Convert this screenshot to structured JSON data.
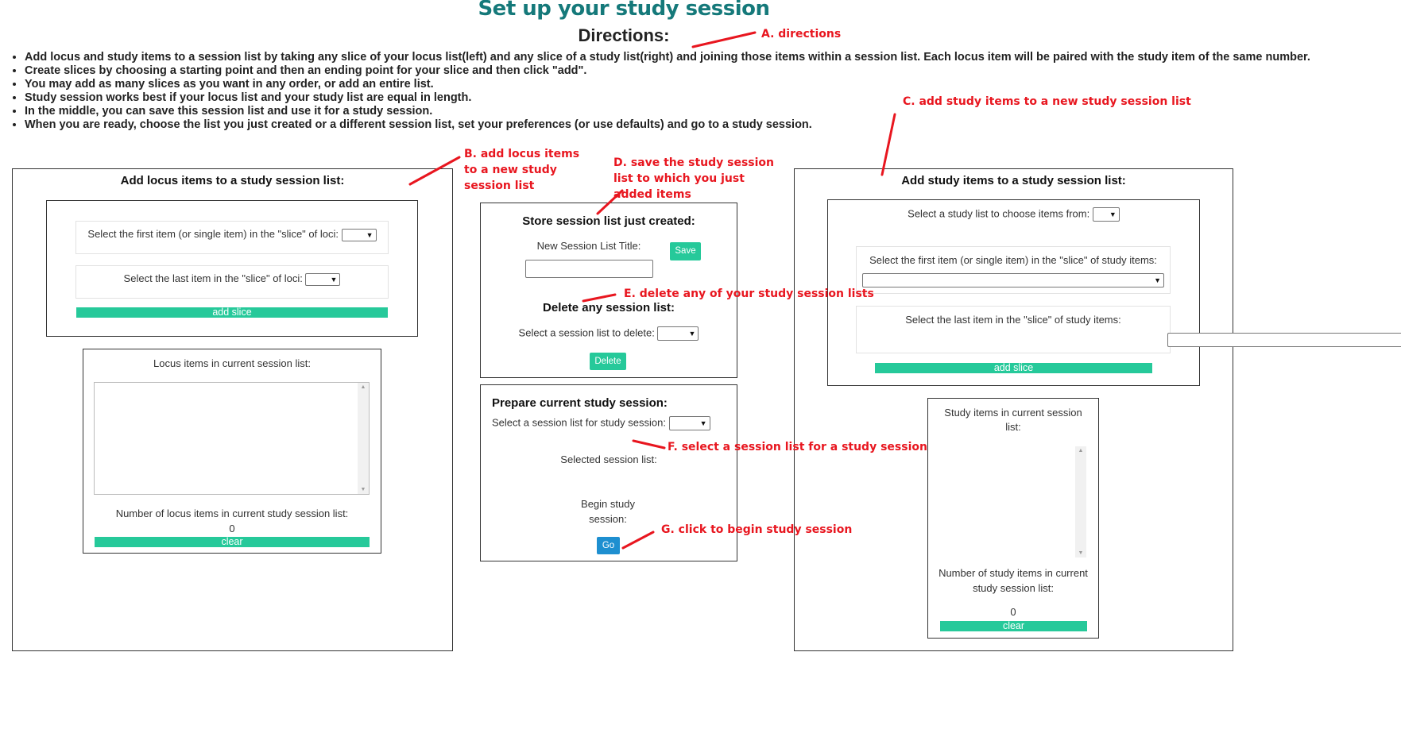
{
  "page": {
    "title": "Set up your study session",
    "directions_heading": "Directions:",
    "directions": [
      "Add locus and study items to a session list by taking any slice of your locus list(left) and any slice of a study list(right) and joining those items within a session list. Each locus item will be paired with the study item of the same number.",
      "Create slices by choosing a starting point and then an ending point for your slice and then click \"add\".",
      "You may add as many slices as you want in any order, or add an entire list.",
      "Study session works best if your locus list and your study list are equal in length.",
      "In the middle, you can save this session list and use it for a study session.",
      "When you are ready, choose the list you just created or a different session list, set your preferences (or use defaults) and go to a study session."
    ]
  },
  "locus_panel": {
    "heading": "Add locus items to a study session list:",
    "first_item_label": "Select the first item (or single item) in the \"slice\" of loci:",
    "last_item_label": "Select the last item in the \"slice\" of loci:",
    "add_slice_label": "add slice",
    "current_items_label": "Locus items in current session list:",
    "count_label": "Number of locus items in current study session list:",
    "count_value": "0",
    "clear_label": "clear"
  },
  "store_panel": {
    "heading": "Store session list just created:",
    "title_label": "New Session List Title:",
    "title_value": "",
    "save_label": "Save",
    "delete_heading": "Delete any session list:",
    "delete_label": "Select a session list to delete:",
    "delete_button": "Delete"
  },
  "prepare_panel": {
    "heading": "Prepare current study session:",
    "select_label": "Select a session list for study session:",
    "selected_label": "Selected session list:",
    "begin_label": "Begin study session:",
    "go_label": "Go"
  },
  "study_panel": {
    "heading": "Add study items to a study session list:",
    "study_list_label": "Select a study list to choose items from:",
    "first_item_label": "Select the first item (or single item) in the \"slice\" of study items:",
    "last_item_label": "Select the last item in the \"slice\" of study items:",
    "add_slice_label": "add slice",
    "current_items_label": "Study items in current session list:",
    "count_label": "Number of study items in current study session list:",
    "count_value": "0",
    "clear_label": "clear"
  },
  "annotations": {
    "a": "A. directions",
    "b": "B. add locus items to a new study session list",
    "c": "C. add study items to a new study session list",
    "d": "D. save the study session list to which you just added items",
    "e": "E. delete any of your study session lists",
    "f": "F. select a session list for a study session",
    "g": "G. click to begin study session"
  },
  "colors": {
    "title": "#15797a",
    "button_green": "#26c99a",
    "button_blue": "#1e8fd0",
    "annotation_red": "#e8161f"
  }
}
